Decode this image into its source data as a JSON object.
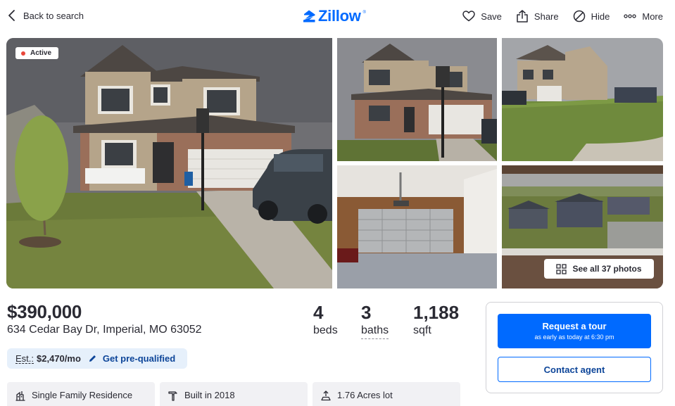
{
  "header": {
    "back_label": "Back to search",
    "logo_text": "Zillow",
    "logo_tm": "®",
    "actions": [
      {
        "icon": "heart-icon",
        "label": "Save"
      },
      {
        "icon": "share-icon",
        "label": "Share"
      },
      {
        "icon": "hide-icon",
        "label": "Hide"
      },
      {
        "icon": "more-icon",
        "label": "More"
      }
    ]
  },
  "gallery": {
    "status_badge": "Active",
    "see_all_label": "See all 37 photos",
    "photos": [
      "house-front-main",
      "house-front-2",
      "house-side-yard",
      "garage-interior",
      "window-view-neighborhood"
    ]
  },
  "listing": {
    "price": "$390,000",
    "address": "634 Cedar Bay Dr, Imperial, MO 63052",
    "beds": {
      "value": "4",
      "label": "beds"
    },
    "baths": {
      "value": "3",
      "label": "baths"
    },
    "sqft": {
      "value": "1,188",
      "label": "sqft"
    }
  },
  "estimate": {
    "label": "Est.:",
    "value": "$2,470/mo",
    "link": "Get pre-qualified"
  },
  "chips": [
    {
      "icon": "building-icon",
      "label": "Single Family Residence"
    },
    {
      "icon": "hammer-icon",
      "label": "Built in 2018"
    },
    {
      "icon": "lot-size-icon",
      "label": "1.76 Acres lot"
    }
  ],
  "contact": {
    "tour_label": "Request a tour",
    "tour_sub": "as early as today at 6:30 pm",
    "contact_label": "Contact agent"
  },
  "colors": {
    "brand_blue": "#006aff",
    "link_blue": "#0d4599",
    "status_red": "#e8473b",
    "text": "#2a2a33",
    "estimate_bg": "#e6f0fb"
  }
}
